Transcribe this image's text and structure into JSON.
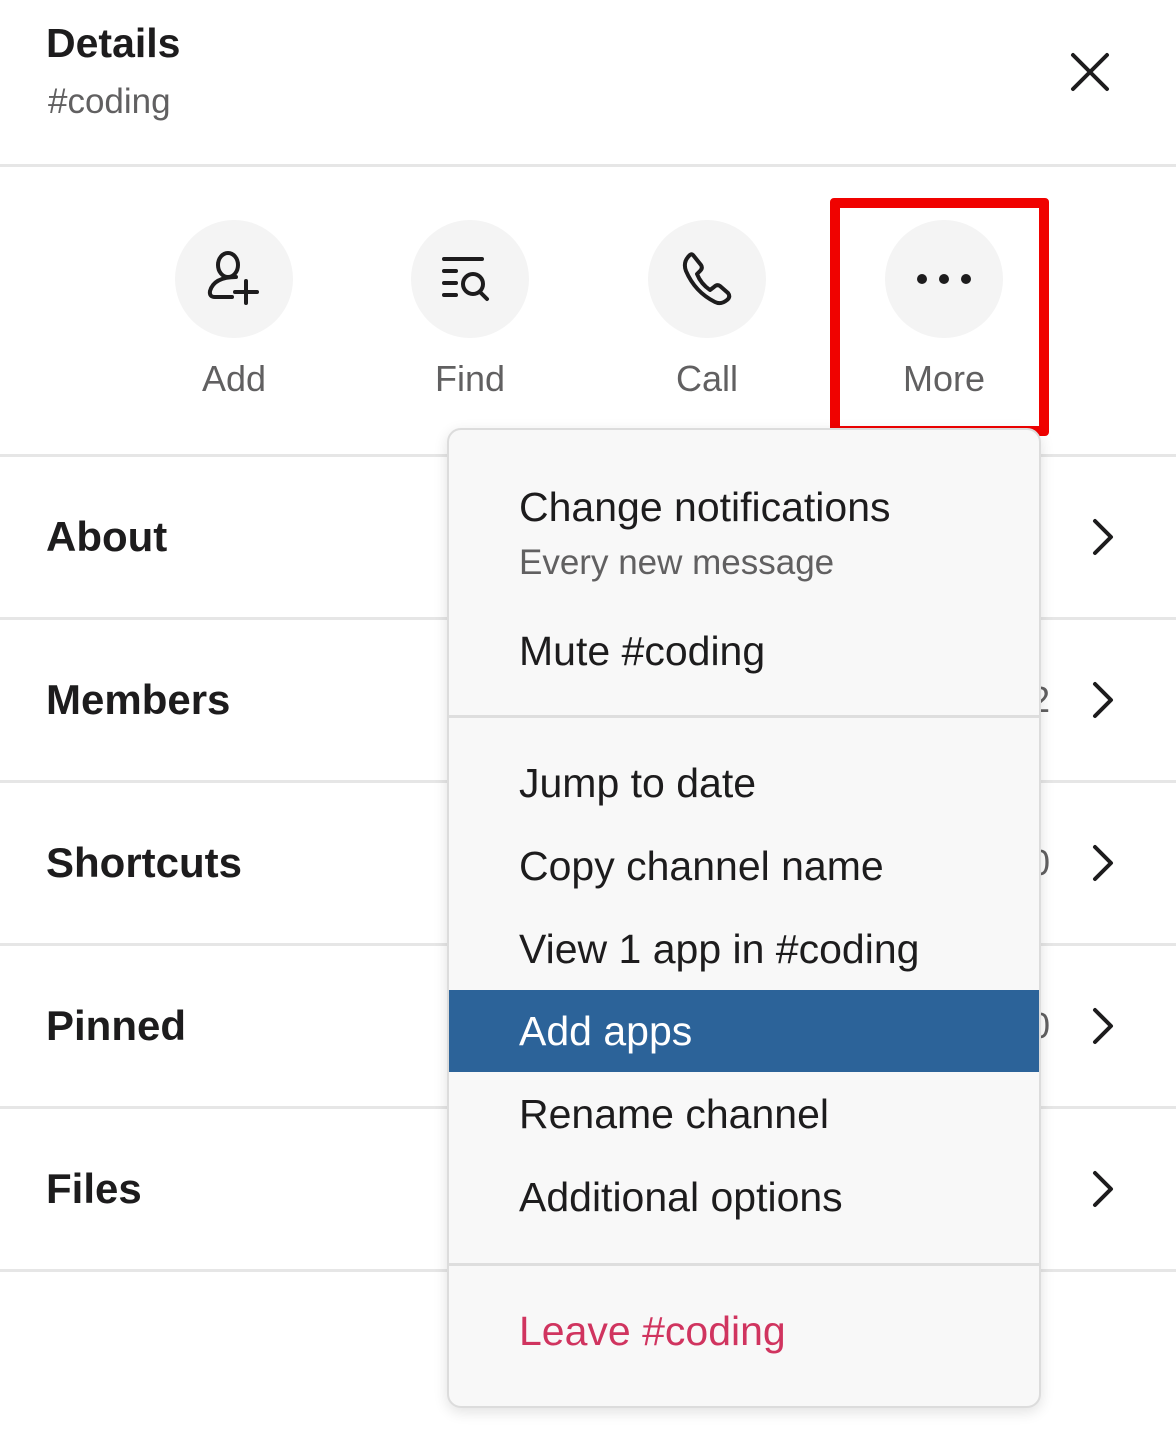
{
  "header": {
    "title": "Details",
    "channel": "#coding"
  },
  "actions": [
    {
      "label": "Add",
      "icon": "add-person-icon"
    },
    {
      "label": "Find",
      "icon": "find-icon"
    },
    {
      "label": "Call",
      "icon": "phone-icon"
    },
    {
      "label": "More",
      "icon": "more-icon"
    }
  ],
  "rows": [
    {
      "label": "About",
      "count": ""
    },
    {
      "label": "Members",
      "count": "2"
    },
    {
      "label": "Shortcuts",
      "count": "0"
    },
    {
      "label": "Pinned",
      "count": "0"
    },
    {
      "label": "Files",
      "count": ""
    }
  ],
  "menu": {
    "notifications": {
      "label": "Change notifications",
      "sub": "Every new message"
    },
    "mute": "Mute #coding",
    "items": [
      "Jump to date",
      "Copy channel name",
      "View 1 app in #coding",
      "Add apps",
      "Rename channel",
      "Additional options"
    ],
    "leave": "Leave #coding",
    "selected": "Add apps"
  },
  "colors": {
    "highlight": "#2c6399",
    "danger": "#d0345f",
    "annotation": "#f00200"
  }
}
